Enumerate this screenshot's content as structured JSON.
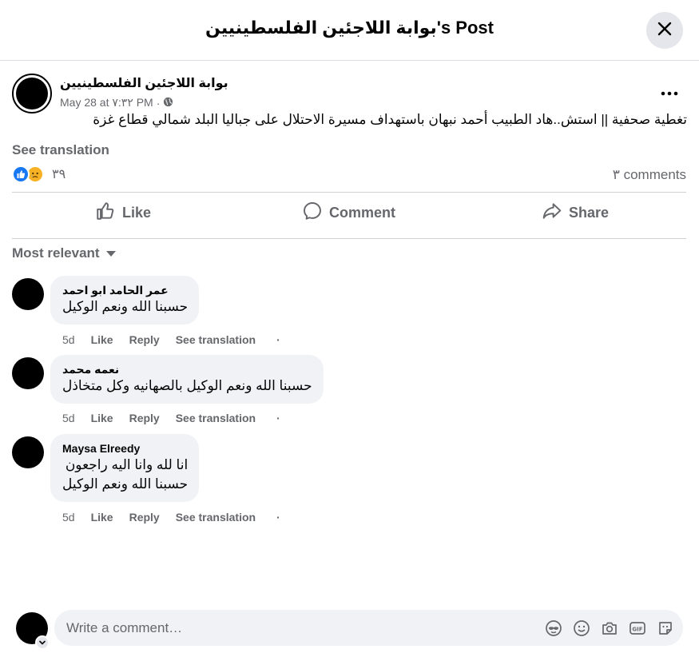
{
  "header": {
    "title": "بوابة اللاجئين الفلسطينيين's Post"
  },
  "post": {
    "author": "بوابة اللاجئين الفلسطينيين",
    "date": "May 28 at ٧:٣٢ PM",
    "separator": "·",
    "text": "تغطية صحفية || استش..هاد الطبيب أحمد نبهان باستهداف مسيرة الاحتلال على جباليا البلد شمالي قطاع غزة",
    "see_translation": "See translation",
    "reaction_count": "٣٩",
    "comments_count": "٣ comments"
  },
  "actions": {
    "like": "Like",
    "comment": "Comment",
    "share": "Share"
  },
  "sort": {
    "label": "Most relevant"
  },
  "comments": [
    {
      "name": "عمر الحامد ابو احمد",
      "lines": [
        "حسبنا الله ونعم الوكيل"
      ],
      "time": "5d",
      "like": "Like",
      "reply": "Reply",
      "translate": "See translation",
      "dot": "·"
    },
    {
      "name": "نعمه محمد",
      "lines": [
        "حسبنا الله ونعم الوكيل بالصهانيه وكل متخاذل"
      ],
      "time": "5d",
      "like": "Like",
      "reply": "Reply",
      "translate": "See translation",
      "dot": "·"
    },
    {
      "name": "Maysa Elreedy",
      "lines": [
        "انا لله وانا اليه راجعون",
        "حسبنا الله ونعم الوكيل"
      ],
      "time": "5d",
      "like": "Like",
      "reply": "Reply",
      "translate": "See translation",
      "dot": "·"
    }
  ],
  "composer": {
    "placeholder": "Write a comment…"
  },
  "icons": {
    "close": "close-icon",
    "more": "more-options-icon",
    "globe": "globe-icon",
    "like": "like-icon",
    "comment": "comment-icon",
    "share": "share-icon",
    "avatar_sticker": "avatar-sticker-icon",
    "emoji": "emoji-icon",
    "camera": "camera-icon",
    "gif": "gif-icon",
    "sticker": "sticker-icon"
  },
  "colors": {
    "primary_text": "#050505",
    "secondary_text": "#65676b",
    "like_blue": "#1877f2",
    "sad_yellow": "#f7b125",
    "bubble": "#f0f2f5"
  }
}
